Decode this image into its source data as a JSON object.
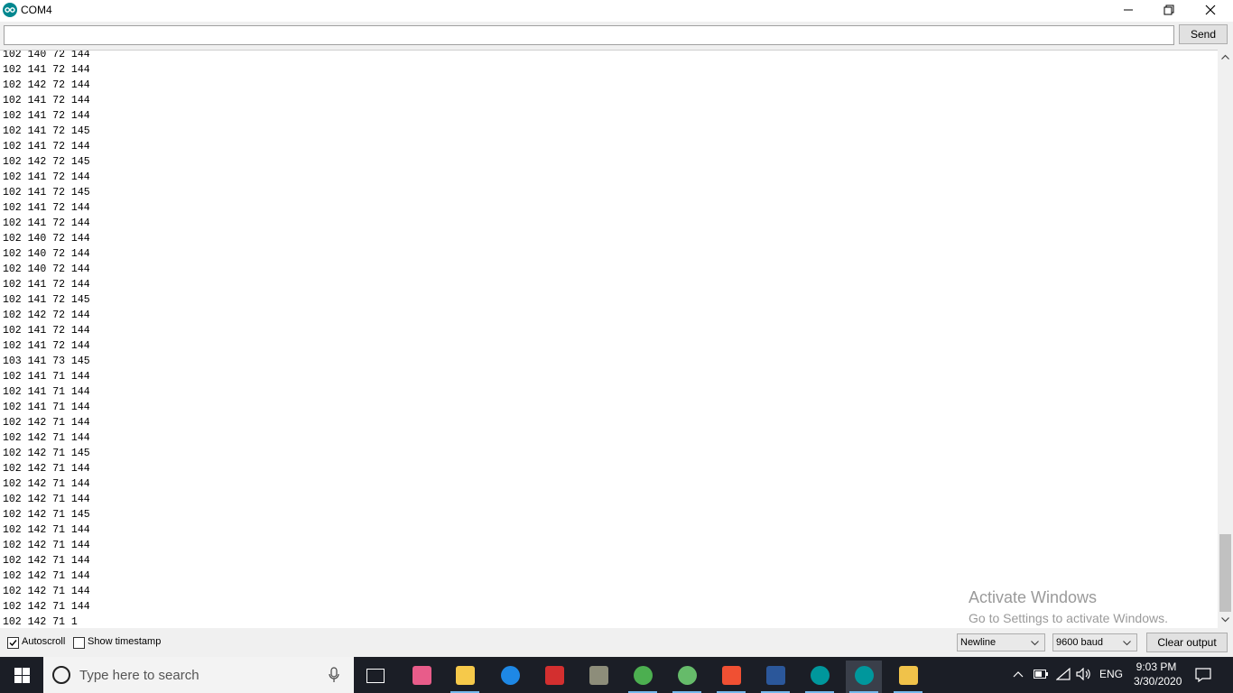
{
  "window": {
    "title": "COM4",
    "minimize_label": "Minimize",
    "restore_label": "Restore",
    "close_label": "Close"
  },
  "input": {
    "value": "",
    "send_label": "Send"
  },
  "output_lines": [
    "102 140 72 144",
    "102 141 72 144",
    "102 142 72 144",
    "102 141 72 144",
    "102 141 72 144",
    "102 141 72 145",
    "102 141 72 144",
    "102 142 72 145",
    "102 141 72 144",
    "102 141 72 145",
    "102 141 72 144",
    "102 141 72 144",
    "102 140 72 144",
    "102 140 72 144",
    "102 140 72 144",
    "102 141 72 144",
    "102 141 72 145",
    "102 142 72 144",
    "102 141 72 144",
    "102 141 72 144",
    "103 141 73 145",
    "102 141 71 144",
    "102 141 71 144",
    "102 141 71 144",
    "102 142 71 144",
    "102 142 71 144",
    "102 142 71 145",
    "102 142 71 144",
    "102 142 71 144",
    "102 142 71 144",
    "102 142 71 145",
    "102 142 71 144",
    "102 142 71 144",
    "102 142 71 144",
    "102 142 71 144",
    "102 142 71 144",
    "102 142 71 144",
    "102 142 71 1"
  ],
  "watermark": {
    "title": "Activate Windows",
    "subtitle": "Go to Settings to activate Windows."
  },
  "footer": {
    "autoscroll_label": "Autoscroll",
    "autoscroll_checked": true,
    "timestamp_label": "Show timestamp",
    "timestamp_checked": false,
    "line_ending": "Newline",
    "baud": "9600 baud",
    "clear_label": "Clear output"
  },
  "taskbar": {
    "search_placeholder": "Type here to search",
    "apps": [
      {
        "name": "task-view-icon",
        "color": "#ffffff"
      },
      {
        "name": "snipping-tool-icon",
        "color": "#e85c8a"
      },
      {
        "name": "file-explorer-icon",
        "color": "#f6c94a"
      },
      {
        "name": "edge-icon",
        "color": "#1e88e5"
      },
      {
        "name": "solidworks-icon",
        "color": "#d32f2f"
      },
      {
        "name": "gimp-icon",
        "color": "#8d8d7a"
      },
      {
        "name": "chrome-icon",
        "color": "#4caf50"
      },
      {
        "name": "atom-icon",
        "color": "#66bb6a"
      },
      {
        "name": "git-icon",
        "color": "#f05033"
      },
      {
        "name": "word-icon",
        "color": "#2b579a"
      },
      {
        "name": "arduino-icon",
        "color": "#00979c"
      },
      {
        "name": "arduino-icon-active",
        "color": "#00979c"
      },
      {
        "name": "paint-icon",
        "color": "#f0c24a"
      }
    ],
    "language": "ENG",
    "time": "9:03 PM",
    "date": "3/30/2020"
  },
  "colors": {
    "arduino_teal": "#00878f",
    "taskbar": "#1b1e26",
    "accent": "#76b9ed"
  }
}
